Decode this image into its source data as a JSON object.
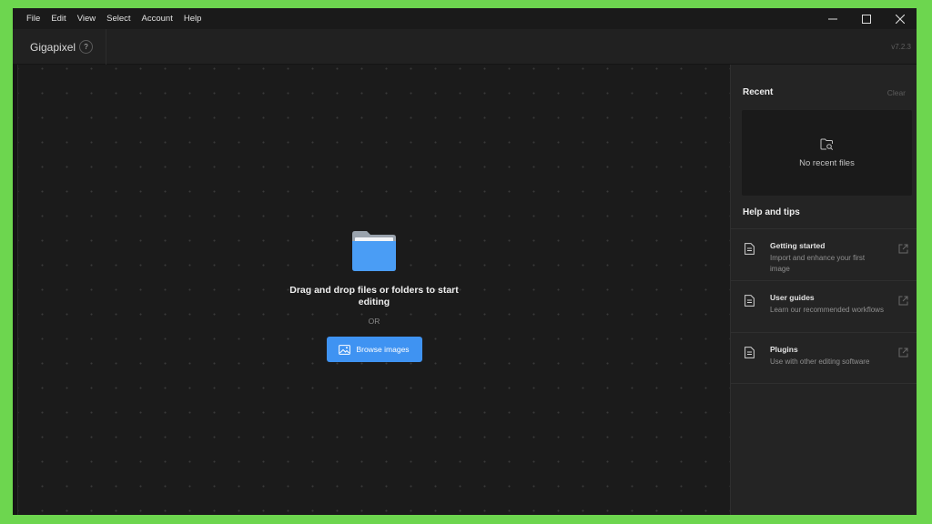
{
  "menu": [
    "File",
    "Edit",
    "View",
    "Select",
    "Account",
    "Help"
  ],
  "app": {
    "name": "Gigapixel",
    "help_badge": "?",
    "version": "v7.2.3"
  },
  "canvas": {
    "drop_text": "Drag and drop files or folders to start editing",
    "or_text": "OR",
    "browse_label": "Browse images"
  },
  "recent": {
    "title": "Recent",
    "clear_label": "Clear",
    "empty_text": "No recent files"
  },
  "help": {
    "title": "Help and tips",
    "items": [
      {
        "title": "Getting started",
        "description": "Import and enhance your first image"
      },
      {
        "title": "User guides",
        "description": "Learn our recommended workflows"
      },
      {
        "title": "Plugins",
        "description": "Use with other editing software"
      }
    ]
  },
  "colors": {
    "accent": "#3f93f2",
    "background": "#1b1b1b",
    "panel": "#242424",
    "frame": "#6dd64f"
  }
}
